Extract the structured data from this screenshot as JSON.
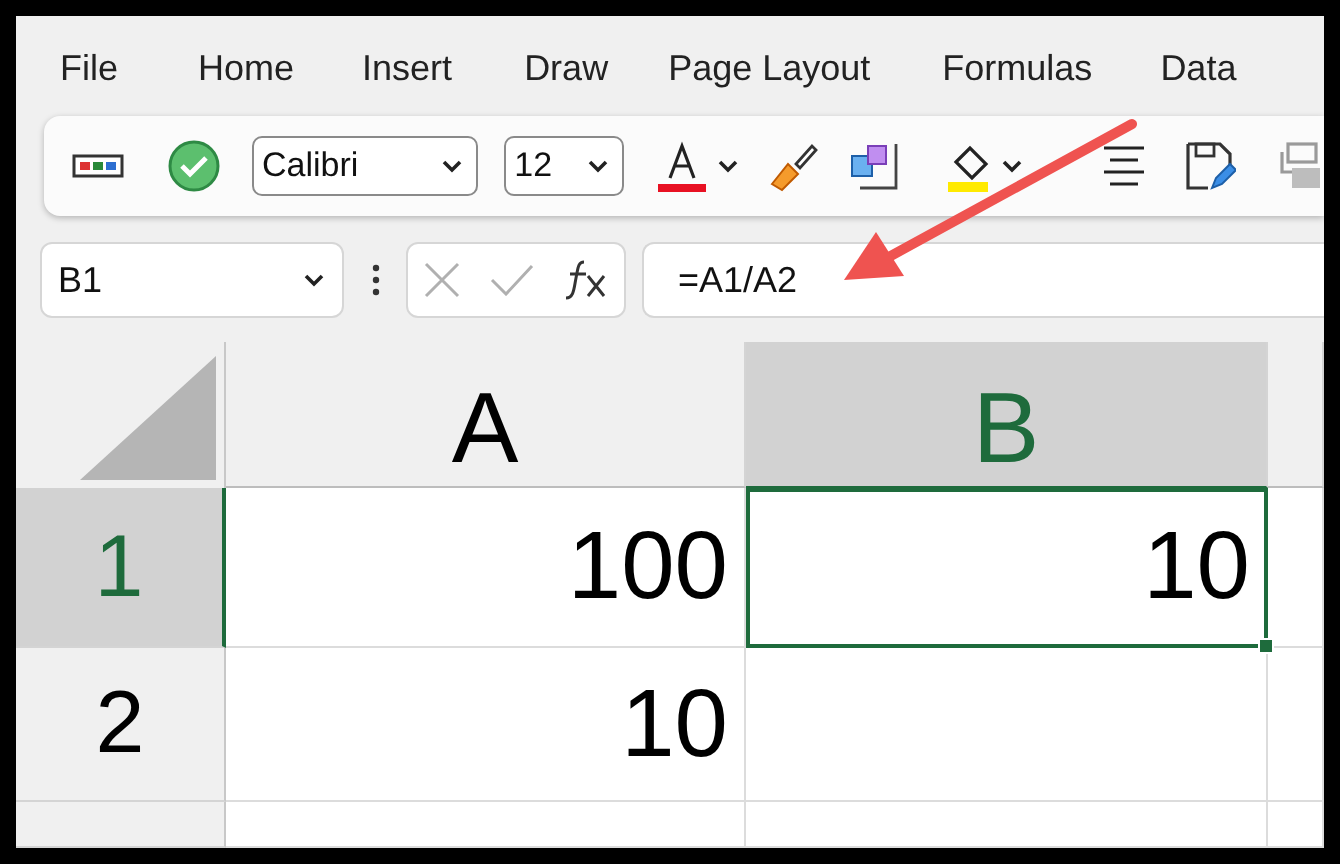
{
  "menu": [
    {
      "label": "File"
    },
    {
      "label": "Home"
    },
    {
      "label": "Insert"
    },
    {
      "label": "Draw"
    },
    {
      "label": "Page Layout"
    },
    {
      "label": "Formulas"
    },
    {
      "label": "Data"
    }
  ],
  "toolbar": {
    "font_name": "Calibri",
    "font_size": "12"
  },
  "formula_bar": {
    "name_box": "B1",
    "formula": "=A1/A2"
  },
  "sheet": {
    "columns": [
      {
        "label": "A",
        "selected": false
      },
      {
        "label": "B",
        "selected": true
      }
    ],
    "rows": [
      {
        "label": "1",
        "selected": true,
        "cells": [
          {
            "value": "100",
            "selected": false
          },
          {
            "value": "10",
            "selected": true
          }
        ]
      },
      {
        "label": "2",
        "selected": false,
        "cells": [
          {
            "value": "10",
            "selected": false
          },
          {
            "selected": false
          }
        ]
      },
      {
        "selected": false,
        "cells": [
          {
            "selected": false
          },
          {
            "selected": false
          }
        ]
      }
    ]
  },
  "annotation": {
    "kind": "arrow"
  }
}
